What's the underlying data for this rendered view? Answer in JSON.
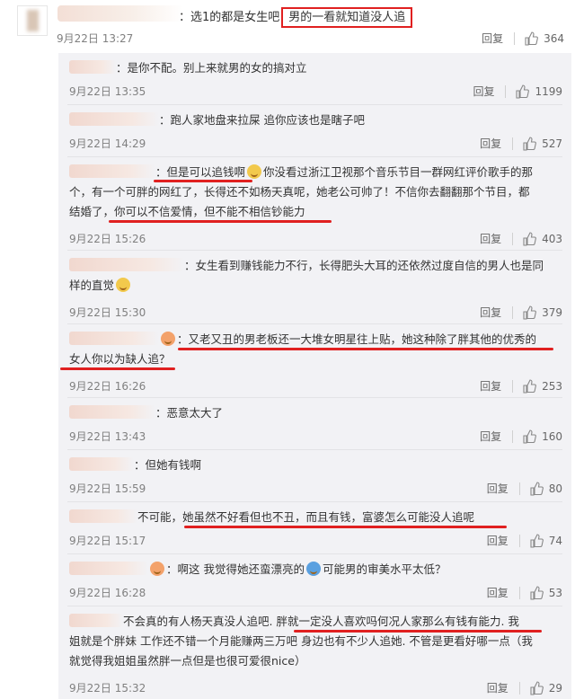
{
  "main_comment": {
    "text_before": "：选1的都是女生吧",
    "text_highlight": "男的一看就知道没人追",
    "time": "9月22日 13:27",
    "reply_label": "回复",
    "likes": "364"
  },
  "replies": [
    {
      "text": "：是你不配。别上来就男的女的搞对立",
      "time": "9月22日 13:35",
      "reply_label": "回复",
      "likes": "1199"
    },
    {
      "text": "：跑人家地盘来拉屎 追你应该也是瞎子吧",
      "time": "9月22日 14:29",
      "reply_label": "回复",
      "likes": "527"
    },
    {
      "line1": "：但是可以追钱啊",
      "line1b": "你没看过浙江卫视那个音乐节目一群网红评价歌手的那",
      "line2": "个，有一个可胖的网红了，长得还不如杨天真呢，她老公可帅了！不信你去翻翻那个节目，都",
      "line3": "结婚了，你可以不信爱情，但不能不相信钞能力",
      "time": "9月22日 15:26",
      "reply_label": "回复",
      "likes": "403"
    },
    {
      "line1": "：女生看到赚钱能力不行，长得肥头大耳的还依然过度自信的男人也是同",
      "line2": "样的直觉",
      "time": "9月22日 15:30",
      "reply_label": "回复",
      "likes": "379"
    },
    {
      "line1": "：又老又丑的男老板还一大堆女明星往上贴，她这种除了胖其他的优秀的",
      "line2": "女人你以为缺人追？",
      "time": "9月22日 16:26",
      "reply_label": "回复",
      "likes": "253"
    },
    {
      "text": "：恶意太大了",
      "time": "9月22日 13:43",
      "reply_label": "回复",
      "likes": "160"
    },
    {
      "text": "：但她有钱啊",
      "time": "9月22日 15:59",
      "reply_label": "回复",
      "likes": "80"
    },
    {
      "text": "不可能，她虽然不好看但也不丑，而且有钱，富婆怎么可能没人追呢",
      "time": "9月22日 15:17",
      "reply_label": "回复",
      "likes": "74"
    },
    {
      "text_before": "：啊这 我觉得她还蛮漂亮的",
      "text_after": "可能男的审美水平太低？",
      "time": "9月22日 16:28",
      "reply_label": "回复",
      "likes": "53"
    },
    {
      "line1": "不会真的有人杨天真没人追吧. 胖就一定没人喜欢吗何况人家那么有钱有能力. 我",
      "line2": "姐就是个胖妹 工作还不错一个月能赚两三万吧 身边也有不少人追她. 不管是更看好哪一点（我",
      "line3": "就觉得我姐姐虽然胖一点但是也很可爱很nice）",
      "time": "9月22日 15:32",
      "reply_label": "回复",
      "likes": "29"
    }
  ]
}
